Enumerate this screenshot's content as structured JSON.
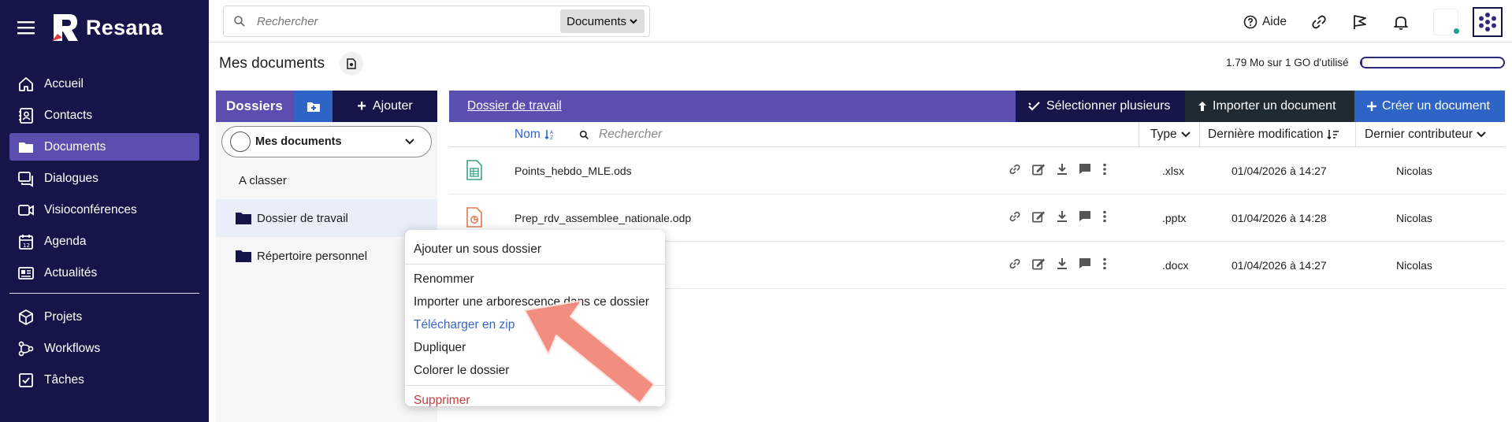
{
  "app": {
    "name": "Resana"
  },
  "sidebar": {
    "items": [
      {
        "label": "Accueil",
        "icon": "home-icon"
      },
      {
        "label": "Contacts",
        "icon": "contacts-icon"
      },
      {
        "label": "Documents",
        "icon": "folder-icon",
        "active": true
      },
      {
        "label": "Dialogues",
        "icon": "chat-icon"
      },
      {
        "label": "Visioconférences",
        "icon": "video-icon"
      },
      {
        "label": "Agenda",
        "icon": "calendar-icon"
      },
      {
        "label": "Actualités",
        "icon": "news-icon"
      }
    ],
    "items2": [
      {
        "label": "Projets",
        "icon": "cube-icon"
      },
      {
        "label": "Workflows",
        "icon": "workflow-icon"
      },
      {
        "label": "Tâches",
        "icon": "checkbox-icon"
      }
    ]
  },
  "topbar": {
    "search_placeholder": "Rechercher",
    "search_scope": "Documents",
    "help_label": "Aide"
  },
  "page": {
    "title": "Mes documents",
    "quota_text": "1.79 Mo sur 1 GO d'utilisé",
    "quota_fraction": 0.0018
  },
  "folders": {
    "title": "Dossiers",
    "add_label": "Ajouter",
    "space": "Mes documents",
    "tree": [
      {
        "label": "A classer",
        "type": "plain"
      },
      {
        "label": "Dossier de travail",
        "type": "folder",
        "selected": true
      },
      {
        "label": "Répertoire personnel",
        "type": "folder"
      }
    ]
  },
  "files": {
    "breadcrumb": "Dossier de travail",
    "select_multiple": "Sélectionner plusieurs",
    "import_doc": "Importer un document",
    "create_doc": "Créer un document",
    "columns": {
      "name": "Nom",
      "search_placeholder": "Rechercher",
      "type": "Type",
      "modified": "Dernière modification",
      "contributor": "Dernier contributeur"
    },
    "rows": [
      {
        "name": "Points_hebdo_MLE.ods",
        "type": ".xlsx",
        "modified": "01/04/2026 à 14:27",
        "contributor": "Nicolas",
        "icon": "spreadsheet-icon",
        "color": "#3aa386"
      },
      {
        "name": "Prep_rdv_assemblee_nationale.odp",
        "type": ".pptx",
        "modified": "01/04/2026 à 14:28",
        "contributor": "Nicolas",
        "icon": "presentation-icon",
        "color": "#e2794d"
      },
      {
        "name": "",
        "type": ".docx",
        "modified": "01/04/2026 à 14:27",
        "contributor": "Nicolas",
        "icon": "document-icon",
        "color": "#3a66c4"
      }
    ]
  },
  "context_menu": {
    "add_subfolder": "Ajouter un sous dossier",
    "rename": "Renommer",
    "import_tree": "Importer une arborescence dans ce dossier",
    "download_zip": "Télécharger en zip",
    "duplicate": "Dupliquer",
    "color": "Colorer le dossier",
    "delete": "Supprimer"
  },
  "colors": {
    "sidebar": "#16154a",
    "accent": "#5a4fae",
    "blue": "#2f64c7",
    "arrow": "#f2897a"
  }
}
